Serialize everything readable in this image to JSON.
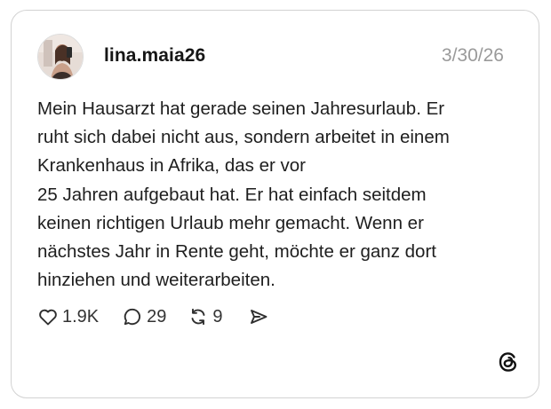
{
  "post": {
    "username": "lina.maia26",
    "date": "3/30/26",
    "text_lines": [
      "Mein Hausarzt hat gerade seinen Jahresurlaub. Er",
      "ruht sich dabei nicht aus, sondern arbeitet in einem",
      "Krankenhaus in Afrika, das er vor",
      "25 Jahren aufgebaut hat. Er hat einfach seitdem",
      "keinen richtigen Urlaub mehr gemacht. Wenn er",
      "nächstes Jahr in Rente geht, möchte er ganz dort",
      "hinziehen und weiterarbeiten."
    ]
  },
  "actions": {
    "likes": "1.9K",
    "replies": "29",
    "reposts": "9"
  },
  "icons": {
    "like": "heart-icon",
    "reply": "speech-bubble-icon",
    "repost": "repost-arrows-icon",
    "share": "send-icon",
    "brand": "threads-logo-icon"
  }
}
